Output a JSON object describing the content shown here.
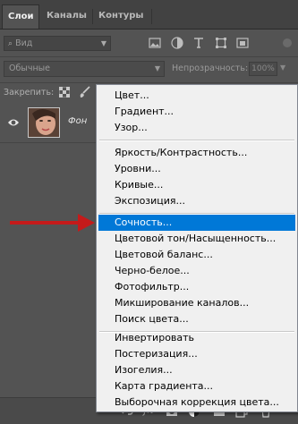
{
  "tabs": [
    {
      "label": "Слои",
      "active": true
    },
    {
      "label": "Каналы",
      "active": false
    },
    {
      "label": "Контуры",
      "active": false
    }
  ],
  "filter": {
    "kind_label": "Вид",
    "icons": [
      "image-filter-icon",
      "adjustment-filter-icon",
      "type-filter-icon",
      "shape-filter-icon",
      "smart-object-filter-icon",
      "filter-toggle-icon"
    ]
  },
  "blend": {
    "mode": "Обычные",
    "opacity_label": "Непрозрачность:",
    "opacity_value": "100%"
  },
  "lock": {
    "label": "Закрепить:"
  },
  "layer": {
    "name": "Фон"
  },
  "menu": {
    "groups": [
      [
        "Цвет...",
        "Градиент...",
        "Узор..."
      ],
      [
        "Яркость/Контрастность...",
        "Уровни...",
        "Кривые...",
        "Экспозиция..."
      ],
      [
        "Сочность...",
        "Цветовой тон/Насыщенность...",
        "Цветовой баланс...",
        "Черно-белое...",
        "Фотофильтр...",
        "Микширование каналов...",
        "Поиск цвета..."
      ],
      [
        "Инвертировать",
        "Постеризация...",
        "Изогелия...",
        "Карта градиента...",
        "Выборочная коррекция цвета..."
      ]
    ],
    "highlighted": "Сочность..."
  },
  "colors": {
    "accent": "#0078d7",
    "arrow": "#c41a1a",
    "panel_bg": "#535353"
  }
}
